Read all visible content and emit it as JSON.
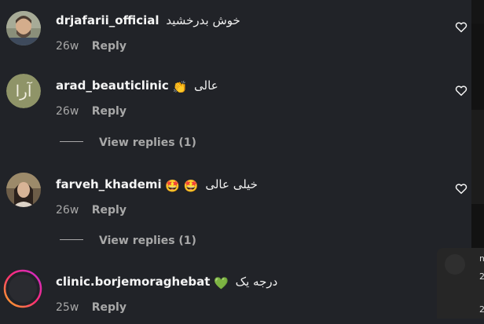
{
  "comments": [
    {
      "username": "drjafarii_official",
      "text": "خوش بدرخشید",
      "emoji": "",
      "time": "26w",
      "reply_label": "Reply",
      "avatar": "portrait-man-beard",
      "view_replies": ""
    },
    {
      "username": "arad_beauticlinic",
      "text": "عالی",
      "emoji": "👏",
      "time": "26w",
      "reply_label": "Reply",
      "avatar": "logo-arad",
      "view_replies": "View replies (1)"
    },
    {
      "username": "farveh_khademi",
      "text": "خیلی عالی",
      "emoji": "🤩 🤩",
      "time": "26w",
      "reply_label": "Reply",
      "avatar": "portrait-woman",
      "view_replies": "View replies (1)"
    },
    {
      "username": "clinic.borjemoraghebat",
      "text": "درجه یک",
      "emoji": "💚",
      "time": "25w",
      "reply_label": "Reply",
      "avatar": "story-ring-avatar",
      "view_replies": ""
    }
  ],
  "popup": {
    "line1": "m",
    "line2": "2",
    "line3": "2"
  },
  "colors": {
    "background": "#212328",
    "text_primary": "#f5f5f5",
    "text_secondary": "#a8a8a8",
    "story_ring_start": "#ff2d74",
    "story_ring_end": "#ffb020"
  },
  "icons": {
    "like": "heart-outline-icon"
  }
}
